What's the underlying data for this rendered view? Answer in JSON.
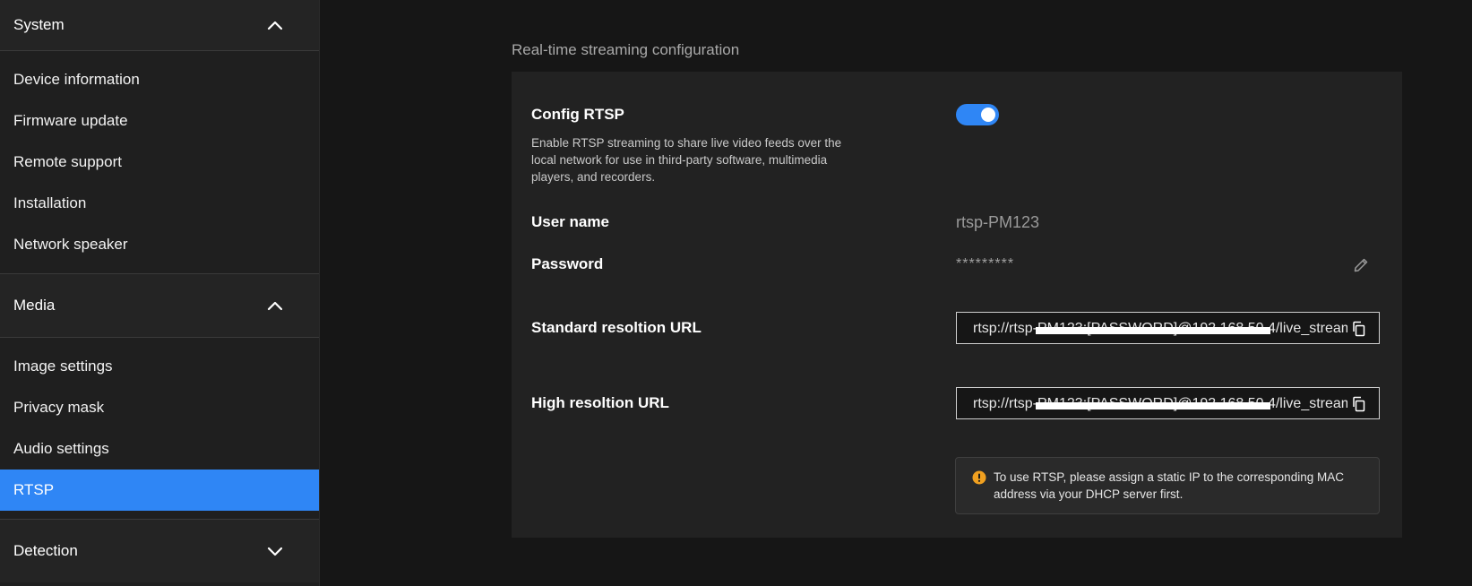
{
  "sidebar": {
    "sections": [
      {
        "title": "System",
        "expanded": true,
        "items": [
          {
            "label": "Device information"
          },
          {
            "label": "Firmware update"
          },
          {
            "label": "Remote support"
          },
          {
            "label": "Installation"
          },
          {
            "label": "Network speaker"
          }
        ]
      },
      {
        "title": "Media",
        "expanded": true,
        "items": [
          {
            "label": "Image settings"
          },
          {
            "label": "Privacy mask"
          },
          {
            "label": "Audio settings"
          },
          {
            "label": "RTSP",
            "active": true
          }
        ]
      },
      {
        "title": "Detection",
        "expanded": false,
        "items": []
      }
    ]
  },
  "main": {
    "section_title": "Real-time streaming configuration",
    "config": {
      "label": "Config RTSP",
      "description": "Enable RTSP streaming to share live video feeds over the local network for use in third-party software, multimedia players, and recorders.",
      "enabled": true
    },
    "username": {
      "label": "User name",
      "value": "rtsp-PM123"
    },
    "password": {
      "label": "Password",
      "value": "*********"
    },
    "standard_url": {
      "label": "Standard resoltion URL",
      "value": "rtsp://rtsp-PM123:[PASSWORD]@192.168.50.4/live_stream"
    },
    "high_url": {
      "label": "High resoltion URL",
      "value": "rtsp://rtsp-PM123:[PASSWORD]@192.168.50.4/live_stream"
    },
    "notice": "To use RTSP, please assign a static IP to the corresponding MAC address via your DHCP server first."
  },
  "colors": {
    "accent": "#2f86f5",
    "warning": "#f0a020",
    "background": "#161616",
    "card": "#222222"
  },
  "icons": {
    "collapse": "chevron-up-icon",
    "expand": "chevron-down-icon",
    "edit": "pencil-icon",
    "copy": "copy-icon",
    "warning": "warning-icon"
  }
}
